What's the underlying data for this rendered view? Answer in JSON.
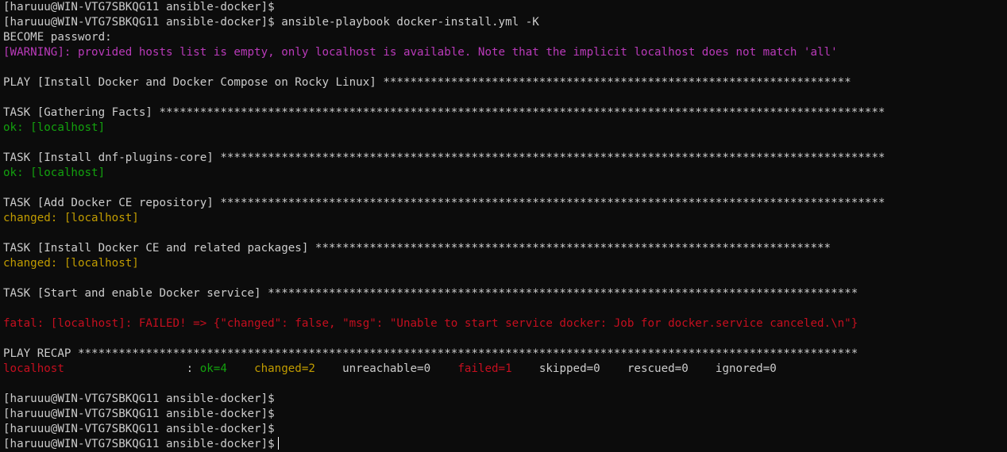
{
  "colors": {
    "background": "#0c0c0c",
    "default": "#cccccc",
    "warning": "#b93ab9",
    "ok": "#13a10e",
    "changed": "#c19c00",
    "fatal": "#c50f1f"
  },
  "lines": [
    [
      {
        "text": "[haruuu@WIN-VTG7SBKQG11 ansible-docker]$",
        "color": "default"
      }
    ],
    [
      {
        "text": "[haruuu@WIN-VTG7SBKQG11 ansible-docker]$ ansible-playbook docker-install.yml -K",
        "color": "default"
      }
    ],
    [
      {
        "text": "BECOME password:",
        "color": "default"
      }
    ],
    [
      {
        "text": "[WARNING]: provided hosts list is empty, only localhost is available. Note that the implicit localhost does not match 'all'",
        "color": "warning"
      }
    ],
    [],
    [
      {
        "text": "PLAY [Install Docker and Docker Compose on Rocky Linux] *********************************************************************",
        "color": "default"
      }
    ],
    [],
    [
      {
        "text": "TASK [Gathering Facts] ***********************************************************************************************************",
        "color": "default"
      }
    ],
    [
      {
        "text": "ok: [localhost]",
        "color": "ok"
      }
    ],
    [],
    [
      {
        "text": "TASK [Install dnf-plugins-core] **************************************************************************************************",
        "color": "default"
      }
    ],
    [
      {
        "text": "ok: [localhost]",
        "color": "ok"
      }
    ],
    [],
    [
      {
        "text": "TASK [Add Docker CE repository] **************************************************************************************************",
        "color": "default"
      }
    ],
    [
      {
        "text": "changed: [localhost]",
        "color": "changed"
      }
    ],
    [],
    [
      {
        "text": "TASK [Install Docker CE and related packages] ****************************************************************************",
        "color": "default"
      }
    ],
    [
      {
        "text": "changed: [localhost]",
        "color": "changed"
      }
    ],
    [],
    [
      {
        "text": "TASK [Start and enable Docker service] ***************************************************************************************",
        "color": "default"
      }
    ],
    [],
    [
      {
        "text": "fatal: [localhost]: FAILED! => {\"changed\": false, \"msg\": \"Unable to start service docker: Job for docker.service canceled.\\n\"}",
        "color": "fatal"
      }
    ],
    [],
    [
      {
        "text": "PLAY RECAP *******************************************************************************************************************",
        "color": "default"
      }
    ],
    [
      {
        "text": "localhost",
        "color": "fatal"
      },
      {
        "text": "                  : ",
        "color": "default"
      },
      {
        "text": "ok=4",
        "color": "ok"
      },
      {
        "text": "    ",
        "color": "default"
      },
      {
        "text": "changed=2",
        "color": "changed"
      },
      {
        "text": "    unreachable=0    ",
        "color": "default"
      },
      {
        "text": "failed=1",
        "color": "fatal"
      },
      {
        "text": "    skipped=0    rescued=0    ignored=0",
        "color": "default"
      }
    ],
    [],
    [
      {
        "text": "[haruuu@WIN-VTG7SBKQG11 ansible-docker]$",
        "color": "default"
      }
    ],
    [
      {
        "text": "[haruuu@WIN-VTG7SBKQG11 ansible-docker]$",
        "color": "default"
      }
    ],
    [
      {
        "text": "[haruuu@WIN-VTG7SBKQG11 ansible-docker]$",
        "color": "default"
      }
    ],
    [
      {
        "text": "[haruuu@WIN-VTG7SBKQG11 ansible-docker]$",
        "color": "default",
        "cursor": true
      }
    ]
  ]
}
